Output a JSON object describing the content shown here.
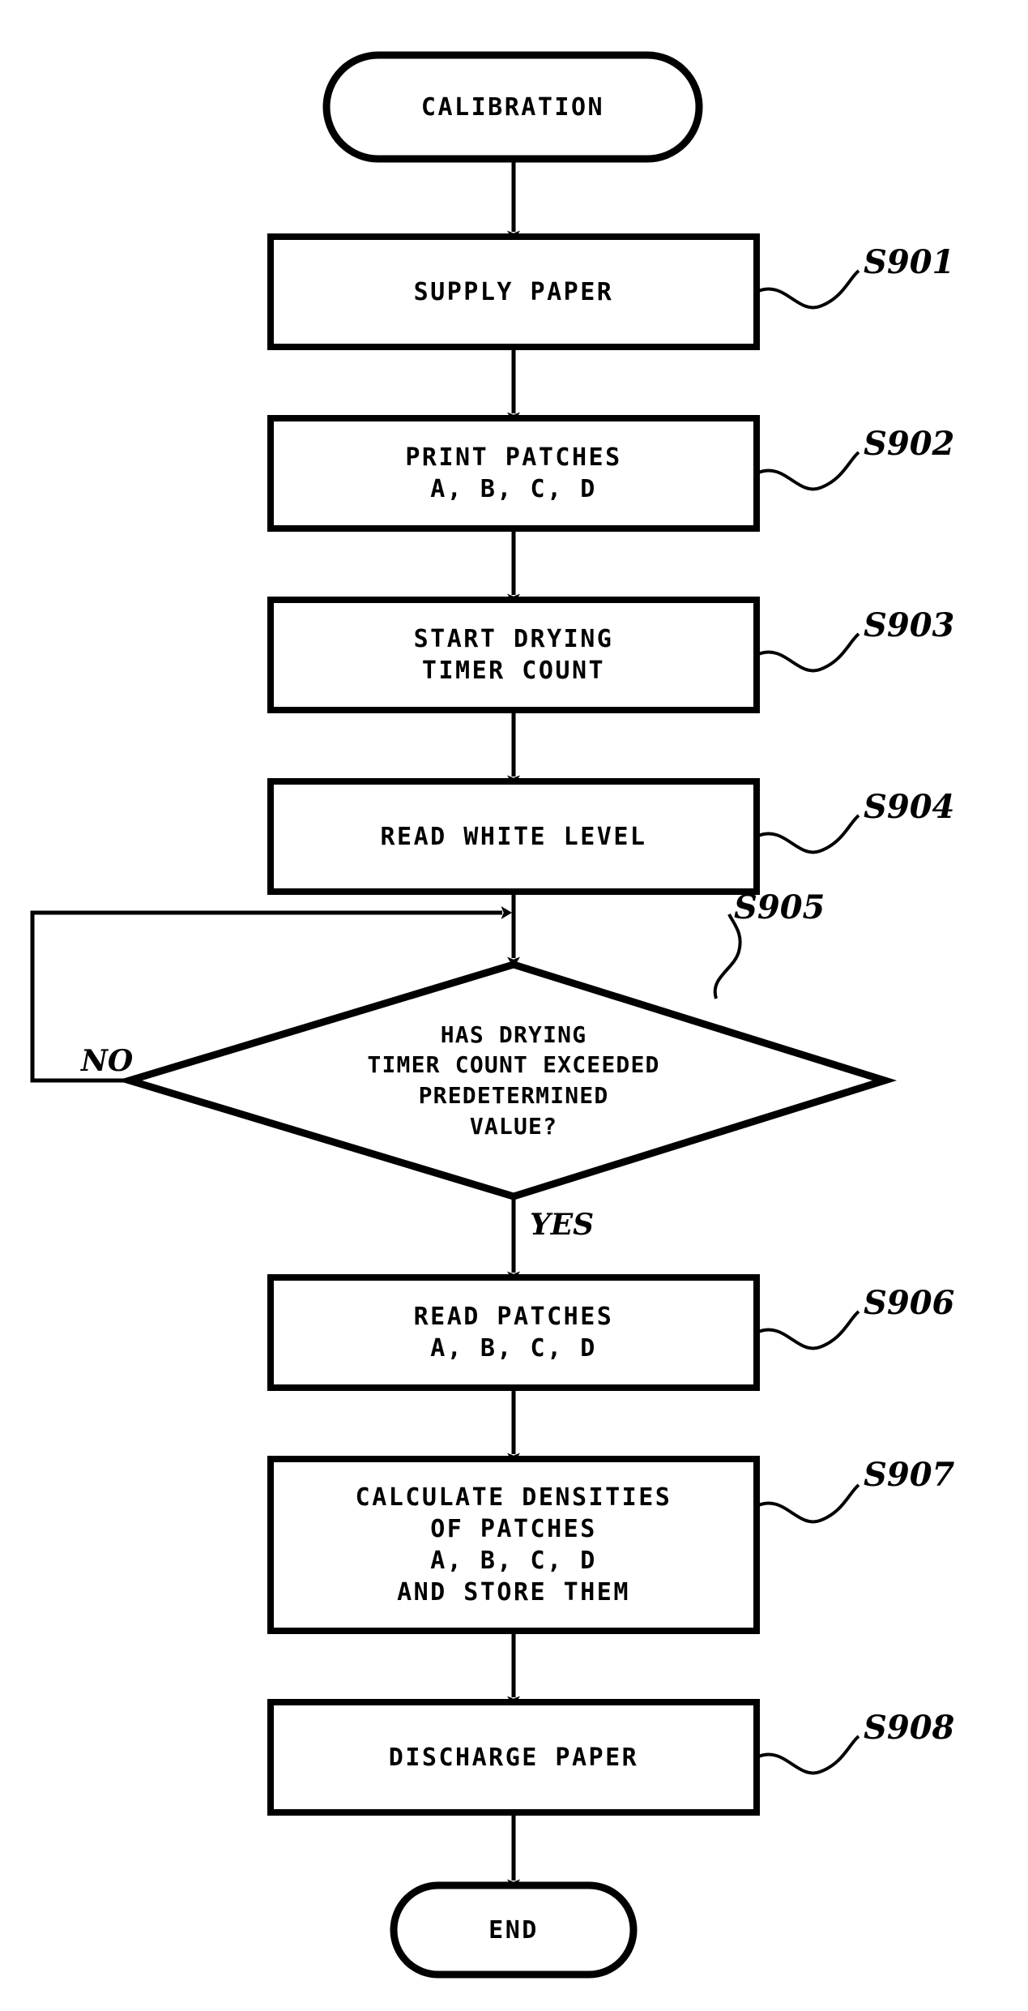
{
  "diagram": {
    "type": "flowchart",
    "title": "CALIBRATION",
    "orientation": "top-to-bottom",
    "nodes": [
      {
        "id": "start",
        "shape": "terminator",
        "lines": [
          "CALIBRATION"
        ],
        "step": null
      },
      {
        "id": "s901",
        "shape": "process",
        "lines": [
          "SUPPLY PAPER"
        ],
        "step": "S901"
      },
      {
        "id": "s902",
        "shape": "process",
        "lines": [
          "PRINT PATCHES",
          "A, B, C, D"
        ],
        "step": "S902"
      },
      {
        "id": "s903",
        "shape": "process",
        "lines": [
          "START DRYING",
          "TIMER COUNT"
        ],
        "step": "S903"
      },
      {
        "id": "s904",
        "shape": "process",
        "lines": [
          "READ WHITE LEVEL"
        ],
        "step": "S904"
      },
      {
        "id": "s905",
        "shape": "decision",
        "lines": [
          "HAS DRYING",
          "TIMER COUNT EXCEEDED",
          "PREDETERMINED",
          "VALUE?"
        ],
        "step": "S905",
        "branch_no": "NO",
        "branch_yes": "YES"
      },
      {
        "id": "s906",
        "shape": "process",
        "lines": [
          "READ PATCHES",
          "A, B, C, D"
        ],
        "step": "S906"
      },
      {
        "id": "s907",
        "shape": "process",
        "lines": [
          "CALCULATE DENSITIES",
          "OF PATCHES",
          "A, B, C, D",
          "AND STORE THEM"
        ],
        "step": "S907"
      },
      {
        "id": "s908",
        "shape": "process",
        "lines": [
          "DISCHARGE PAPER"
        ],
        "step": "S908"
      },
      {
        "id": "end",
        "shape": "terminator",
        "lines": [
          "END"
        ],
        "step": null
      }
    ],
    "colors": {
      "stroke": "#000000",
      "fill": "#ffffff",
      "text": "#000000"
    }
  }
}
